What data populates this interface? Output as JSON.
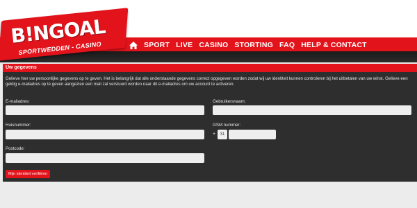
{
  "brand": {
    "name": "B!NGOAL",
    "tagline": "SPORTWEDDEN - CASINO"
  },
  "nav": {
    "items": [
      "SPORT",
      "LIVE",
      "CASINO",
      "STORTING",
      "FAQ",
      "HELP & CONTACT"
    ]
  },
  "panel": {
    "title": "Uw gegevens",
    "intro": "Gelieve hier uw persoonlijke gegevens op te geven. Het is belangrijk dat alle onderstaande gegevens correct opgegeven worden zodat wij uw identiteit kunnen controleren bij het uitbetalen van uw winst. Gelieve een geldig e-mailadres op te geven aangezien een mail zal verstuurd worden naar dit e-mailadres om uw account te activeren."
  },
  "form": {
    "email_label": "E-mailadres:",
    "username_label": "Gebruikersnaam:",
    "housenumber_label": "Huisnummer:",
    "gsm_label": "GSM nummer:",
    "gsm_plus": "+",
    "gsm_prefix": "31",
    "postcode_label": "Postcode:",
    "submit_label": "Mijn identiteit verifiëren"
  },
  "colors": {
    "accent": "#e3131b",
    "panel": "#2e2e2e"
  }
}
